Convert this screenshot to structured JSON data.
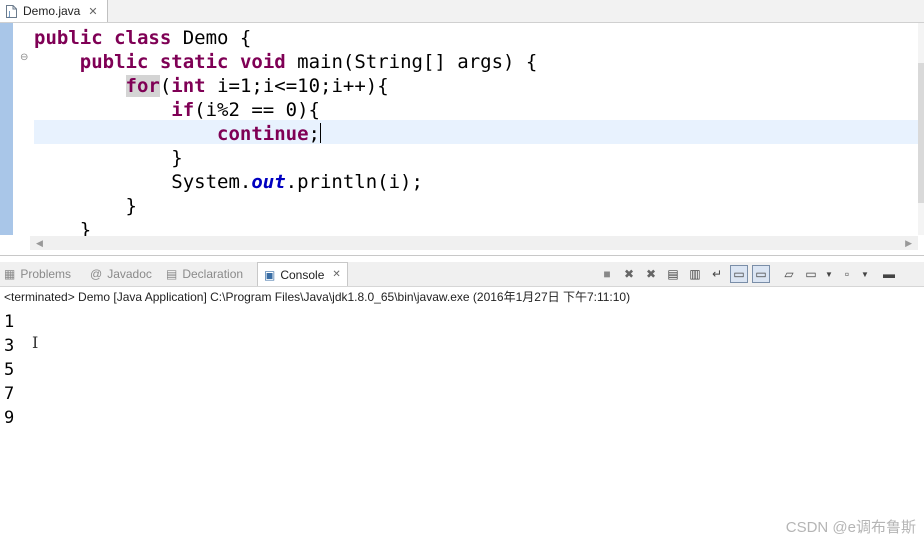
{
  "editor": {
    "tab_label": "Demo.java",
    "lines": [
      {
        "parts": [
          {
            "t": "public",
            "c": "kw"
          },
          {
            "t": " "
          },
          {
            "t": "class",
            "c": "kw"
          },
          {
            "t": " Demo {"
          }
        ]
      },
      {
        "parts": [
          {
            "t": "    "
          },
          {
            "t": "public",
            "c": "kw"
          },
          {
            "t": " "
          },
          {
            "t": "static",
            "c": "kw"
          },
          {
            "t": " "
          },
          {
            "t": "void",
            "c": "kw"
          },
          {
            "t": " main(String[] args) {"
          }
        ]
      },
      {
        "parts": [
          {
            "t": "        "
          },
          {
            "t": "for",
            "c": "kw kw-hl"
          },
          {
            "t": "("
          },
          {
            "t": "int",
            "c": "kw"
          },
          {
            "t": " i=1;i<=10;i++){"
          }
        ]
      },
      {
        "parts": [
          {
            "t": "            "
          },
          {
            "t": "if",
            "c": "kw"
          },
          {
            "t": "(i%2 == 0){"
          }
        ]
      },
      {
        "parts": [
          {
            "t": "                "
          },
          {
            "t": "continue",
            "c": "kw"
          },
          {
            "t": ";"
          }
        ],
        "caret": true
      },
      {
        "parts": [
          {
            "t": "            }"
          }
        ]
      },
      {
        "parts": [
          {
            "t": "            System."
          },
          {
            "t": "out",
            "c": "it"
          },
          {
            "t": ".println(i);"
          }
        ]
      },
      {
        "parts": [
          {
            "t": "        }"
          }
        ]
      },
      {
        "parts": [
          {
            "t": "    }"
          }
        ]
      }
    ]
  },
  "views": {
    "problems": "Problems",
    "javadoc": "Javadoc",
    "declaration": "Declaration",
    "console": "Console"
  },
  "console": {
    "status": "<terminated> Demo [Java Application] C:\\Program Files\\Java\\jdk1.8.0_65\\bin\\javaw.exe (2016年1月27日 下午7:11:10)",
    "output": [
      "1",
      "3",
      "5",
      "7",
      "9"
    ]
  },
  "watermark": "CSDN @e调布鲁斯",
  "colors": {
    "keyword": "#7f0055",
    "field": "#0000c0",
    "current_line": "#e8f2fe",
    "gutter": "#a9c6e8"
  }
}
